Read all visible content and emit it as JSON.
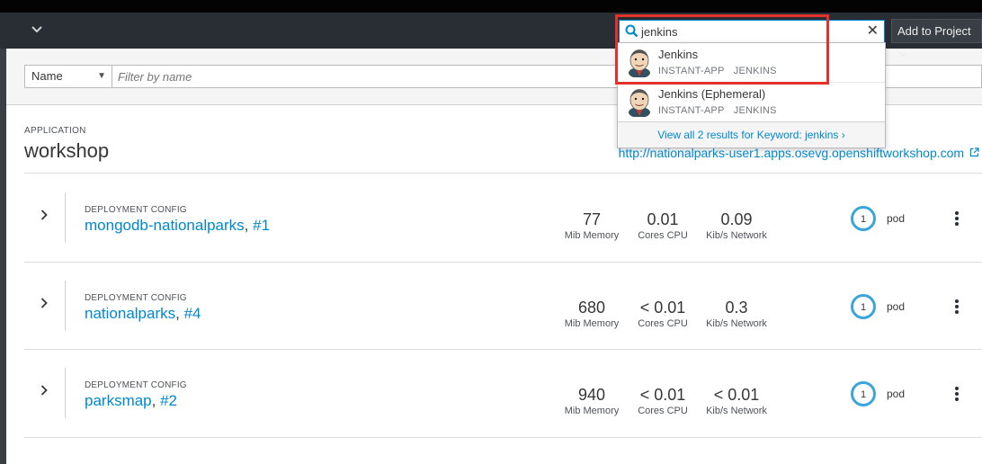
{
  "header": {
    "search_value": "jenkins",
    "add_to_project_label": "Add to Project"
  },
  "search_results": {
    "items": [
      {
        "title": "Jenkins",
        "tags": [
          "INSTANT-APP",
          "JENKINS"
        ]
      },
      {
        "title": "Jenkins (Ephemeral)",
        "tags": [
          "INSTANT-APP",
          "JENKINS"
        ]
      }
    ],
    "view_all_label": "View all 2 results for Keyword: jenkins ›"
  },
  "filter": {
    "field_selected": "Name",
    "placeholder": "Filter by name"
  },
  "application": {
    "label": "APPLICATION",
    "name": "workshop",
    "route_url": "http://nationalparks-user1.apps.osevg.openshiftworkshop.com"
  },
  "deployments": [
    {
      "kind": "DEPLOYMENT CONFIG",
      "name": "mongodb-nationalparks",
      "revision": "#1",
      "memory": "77",
      "memory_unit": "Mib Memory",
      "cpu": "0.01",
      "cpu_unit": "Cores CPU",
      "network": "0.09",
      "network_unit": "Kib/s Network",
      "pods": "1",
      "pods_label": "pod"
    },
    {
      "kind": "DEPLOYMENT CONFIG",
      "name": "nationalparks",
      "revision": "#4",
      "memory": "680",
      "memory_unit": "Mib Memory",
      "cpu": "< 0.01",
      "cpu_unit": "Cores CPU",
      "network": "0.3",
      "network_unit": "Kib/s Network",
      "pods": "1",
      "pods_label": "pod"
    },
    {
      "kind": "DEPLOYMENT CONFIG",
      "name": "parksmap",
      "revision": "#2",
      "memory": "940",
      "memory_unit": "Mib Memory",
      "cpu": "< 0.01",
      "cpu_unit": "Cores CPU",
      "network": "< 0.01",
      "network_unit": "Kib/s Network",
      "pods": "1",
      "pods_label": "pod"
    }
  ],
  "colors": {
    "accent": "#0088ce",
    "highlight": "#e4322b",
    "donut": "#39a5dc",
    "masthead": "#292e34"
  }
}
